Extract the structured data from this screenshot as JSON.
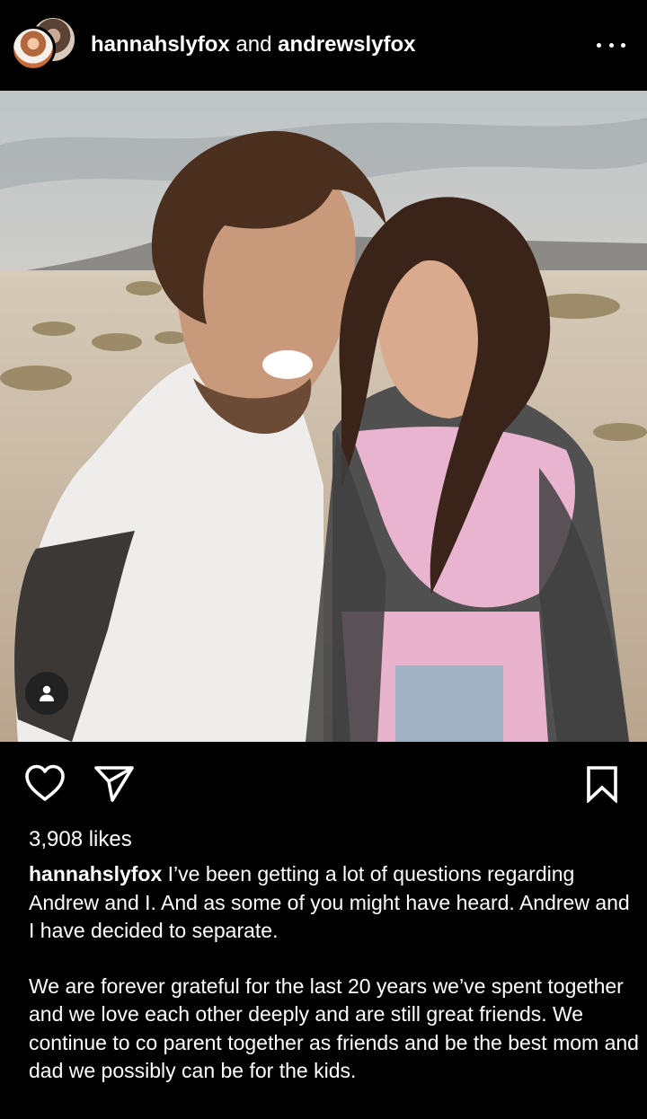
{
  "header": {
    "owner_primary": "hannahslyfox",
    "owner_joiner": " and ",
    "owner_secondary": "andrewslyfox"
  },
  "post": {
    "likes": "3,908 likes",
    "caption_user": "hannahslyfox",
    "caption_line_1": " I’ve been getting a lot of questions regarding Andrew and I. And as some of you might have heard. Andrew and I have decided to separate.",
    "caption_line_2": "We are forever grateful for the last 20 years we’ve spent together and we love each other deeply and are still great friends. We continue to co parent together as friends and be the best mom and dad we possibly can be for the kids."
  },
  "icons": {
    "more": "more-options-icon",
    "tag": "user-tag-icon",
    "like": "heart-icon",
    "share": "share-icon",
    "save": "bookmark-icon"
  },
  "colors": {
    "background": "#000000",
    "text": "#ffffff"
  }
}
